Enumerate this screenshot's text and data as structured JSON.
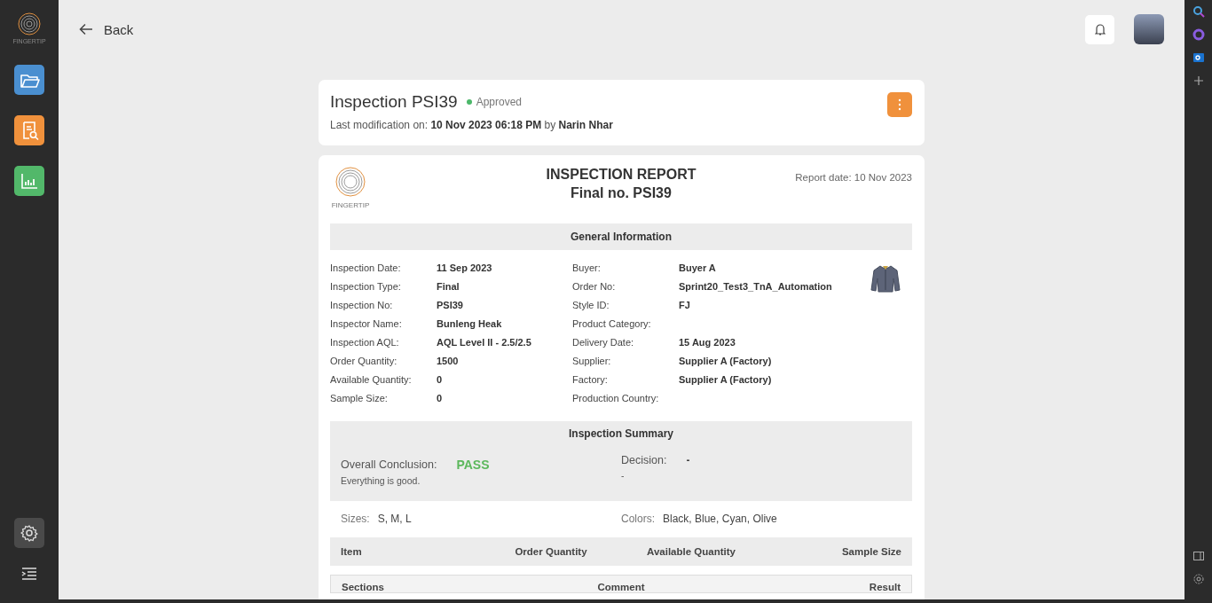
{
  "sidebar": {
    "logo_text": "FINGERTIP",
    "items": [
      {
        "kind": "folder",
        "color": "#4a8fd0"
      },
      {
        "kind": "report",
        "color": "#f0913c"
      },
      {
        "kind": "chart",
        "color": "#52b86a"
      }
    ],
    "bottom_items": [
      {
        "kind": "settings"
      },
      {
        "kind": "menu"
      }
    ]
  },
  "back": "Back",
  "inspection": {
    "title": "Inspection PSI39",
    "status": "Approved",
    "modification": "Last modification on: **10 Nov 2023 06:18 PM** by **Narin Nhar**"
  },
  "report": {
    "logo_text": "FINGERTIP",
    "title": "INSPECTION REPORT",
    "subtitle": "Final no. PSI39",
    "report_date": "Report date: 10 Nov 2023",
    "general_information": {
      "heading": "General Information",
      "left": [
        {
          "label": "Inspection Date:",
          "value": "11 Sep 2023"
        },
        {
          "label": "Inspection Type:",
          "value": "Final"
        },
        {
          "label": "Inspection No:",
          "value": "PSI39"
        },
        {
          "label": "Inspector Name:",
          "value": "Bunleng Heak"
        },
        {
          "label": "Inspection AQL:",
          "value": "AQL Level II - 2.5/2.5"
        },
        {
          "label": "Order Quantity:",
          "value": "1500"
        },
        {
          "label": "Available Quantity:",
          "value": "0"
        },
        {
          "label": "Sample Size:",
          "value": "0"
        }
      ],
      "right": [
        {
          "label": "Buyer:",
          "value": "Buyer A"
        },
        {
          "label": "Order No:",
          "value": "Sprint20_Test3_TnA_Automation"
        },
        {
          "label": "Style ID:",
          "value": "FJ"
        },
        {
          "label": "Product Category:"
        },
        {
          "label": "Delivery Date:",
          "value": "15 Aug 2023"
        },
        {
          "label": "Supplier:",
          "value": "Supplier A (Factory)"
        },
        {
          "label": "Factory:",
          "value": "Supplier A (Factory)"
        },
        {
          "label": "Production Country:"
        }
      ]
    },
    "summary": {
      "heading": "Inspection Summary",
      "conclusion_label": "Overall Conclusion:",
      "conclusion": "PASS",
      "conclusion_note": "Everything is good.",
      "decision_label": "Decision:",
      "decision": "-",
      "decision_note": "-"
    },
    "sizes_label": "Sizes:",
    "sizes": "S, M, L",
    "colors_label": "Colors:",
    "colors": "Black, Blue, Cyan, Olive",
    "items_table": {
      "columns": [
        "Item",
        "Order Quantity",
        "Available Quantity",
        "Sample Size"
      ]
    },
    "sections_table": {
      "columns": [
        "Sections",
        "Comment",
        "Result"
      ]
    }
  }
}
